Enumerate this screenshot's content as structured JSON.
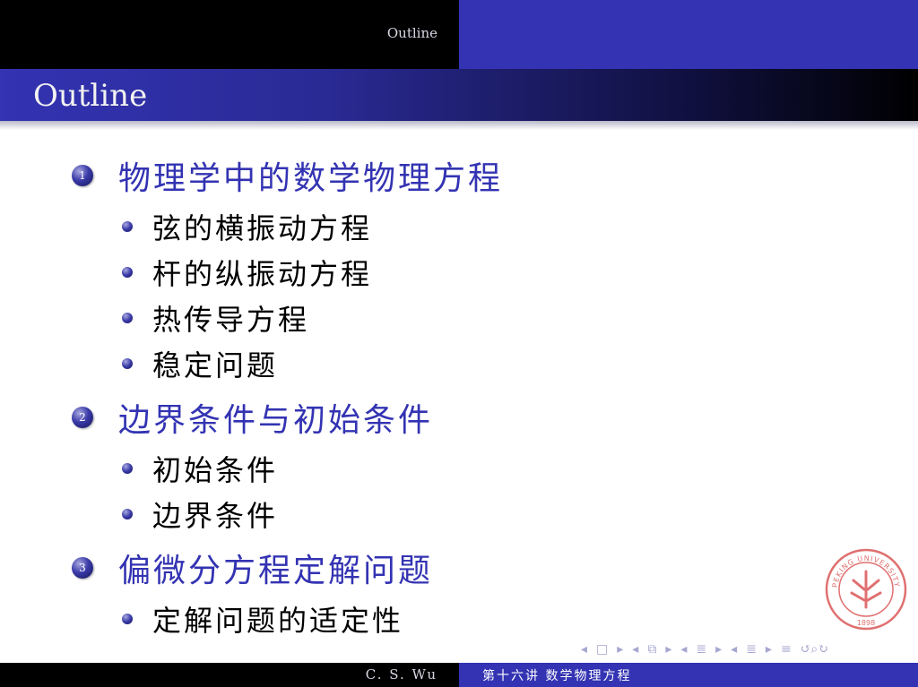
{
  "header": {
    "section_label": "Outline"
  },
  "frame": {
    "title": "Outline"
  },
  "outline": [
    {
      "number": "1",
      "title": "物理学中的数学物理方程",
      "items": [
        "弦的横振动方程",
        "杆的纵振动方程",
        "热传导方程",
        "稳定问题"
      ]
    },
    {
      "number": "2",
      "title": "边界条件与初始条件",
      "items": [
        "初始条件",
        "边界条件"
      ]
    },
    {
      "number": "3",
      "title": "偏微分方程定解问题",
      "items": [
        "定解问题的适定性"
      ]
    }
  ],
  "seal": {
    "top_text": "PEKING UNIVERSITY",
    "year": "1898"
  },
  "nav": {
    "frame_prev": "◂",
    "frame_icon": "□",
    "frame_next": "▸",
    "sub_prev": "◂",
    "sub_icon": "⧉",
    "sub_next": "▸",
    "sec_prev": "◂",
    "sec_icon": "≣",
    "sec_next": "▸",
    "subsec_prev": "◂",
    "subsec_icon": "≣",
    "subsec_next": "▸",
    "align_icon": "≡",
    "search_icon": "↺⌕↻"
  },
  "footer": {
    "author": "C. S. Wu",
    "lecture": "第十六讲 数学物理方程"
  },
  "colors": {
    "accent": "#3333b3",
    "dark": "#000000"
  }
}
